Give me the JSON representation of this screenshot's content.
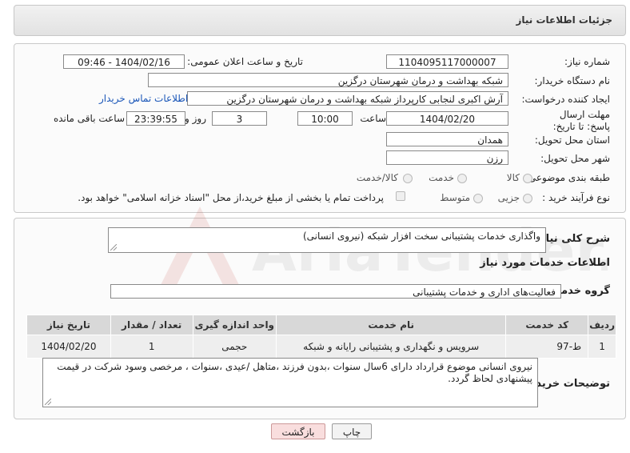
{
  "header": {
    "title": "جزئیات اطلاعات نیاز"
  },
  "form": {
    "need_number_label": "شماره نیاز:",
    "need_number": "1104095117000007",
    "announce_label": "تاریخ و ساعت اعلان عمومی:",
    "announce_value": "1404/02/16 - 09:46",
    "buyer_org_label": "نام دستگاه خریدار:",
    "buyer_org": "شبکه بهداشت و درمان شهرستان درگزین",
    "creator_label": "ایجاد کننده درخواست:",
    "creator": "آرش اکبری لنجابی کارپرداز شبکه بهداشت و درمان شهرستان درگزین",
    "contact_link": "اطلاعات تماس خریدار",
    "deadline_label": "مهلت ارسال پاسخ: تا تاریخ:",
    "deadline_date": "1404/02/20",
    "time_label": "ساعت",
    "deadline_time": "10:00",
    "days_value": "3",
    "days_label": "روز و",
    "remaining_time": "23:39:55",
    "remaining_label": "ساعت باقی مانده",
    "province_label": "استان محل تحویل:",
    "province": "همدان",
    "city_label": "شهر محل تحویل:",
    "city": "رزن",
    "category_label": "طبقه بندی موضوعی:",
    "category_options": [
      "کالا",
      "خدمت",
      "کالا/خدمت"
    ],
    "purchase_type_label": "نوع فرآیند خرید :",
    "purchase_options": [
      "جزیی",
      "متوسط"
    ],
    "payment_note": "پرداخت تمام یا بخشی از مبلغ خرید،از محل \"اسناد خزانه اسلامی\" خواهد بود."
  },
  "summary": {
    "label": "شرح کلی نیاز:",
    "value": "واگذاری خدمات پشتیبانی سخت افزار شبکه (نیروی انسانی)"
  },
  "services": {
    "section_title": "اطلاعات خدمات مورد نیاز",
    "group_label": "گروه خدمت:",
    "group_value": "فعالیت‌های اداری و خدمات پشتیبانی",
    "columns": [
      "ردیف",
      "کد خدمت",
      "نام خدمت",
      "واحد اندازه گیری",
      "تعداد / مقدار",
      "تاریخ نیاز"
    ],
    "rows": [
      [
        "1",
        "ط-97",
        "سرویس و نگهداری و پشتیبانی رایانه و شبکه",
        "حجمی",
        "1",
        "1404/02/20"
      ]
    ]
  },
  "notes": {
    "label": "توضیحات خریدار:",
    "value": "نیروی انسانی موضوع قرارداد دارای 6سال سنوات ،بدون فرزند ،متاهل /عیدی ،سنوات ، مرخصی وسود شرکت در قیمت پیشنهادی لحاظ گردد."
  },
  "buttons": {
    "print": "چاپ",
    "back": "بازگشت"
  },
  "watermark_text": "AriaTender.neT"
}
